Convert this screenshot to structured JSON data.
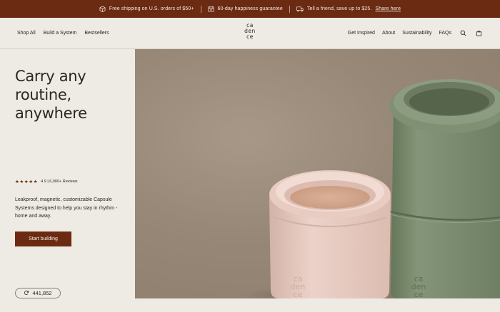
{
  "announcement": {
    "items": [
      {
        "icon": "package-icon",
        "text": "Free shipping on U.S. orders of $50+"
      },
      {
        "icon": "calendar-check-icon",
        "text": "60-day happiness guarantee"
      },
      {
        "icon": "truck-icon",
        "text": "Tell a friend, save up to $25.",
        "link": "Share here"
      }
    ]
  },
  "header": {
    "nav_left": [
      "Shop All",
      "Build a System",
      "Bestsellers"
    ],
    "logo": [
      "ca",
      "den",
      "ce"
    ],
    "nav_right": [
      "Get Inspired",
      "About",
      "Sustainability",
      "FAQs"
    ],
    "icons": [
      "search-icon",
      "cart-icon"
    ]
  },
  "hero": {
    "title": "Carry any routine, anywhere",
    "stars": "★★★★★",
    "rating_text": "4.9 | 6,000+ Reviews",
    "description": "Leakproof, magnetic, customizable Capsule Systems designed to help you stay in rhythm - home and away.",
    "cta_label": "Start building",
    "counter_value": "441,852",
    "image_embossed_text": [
      "ca",
      "den",
      "ce"
    ]
  },
  "colors": {
    "brand": "#6b2a12",
    "background": "#eeebe4",
    "text": "#2b2623",
    "pink_capsule": "#e7cbc2",
    "green_capsule": "#7c8d72"
  }
}
